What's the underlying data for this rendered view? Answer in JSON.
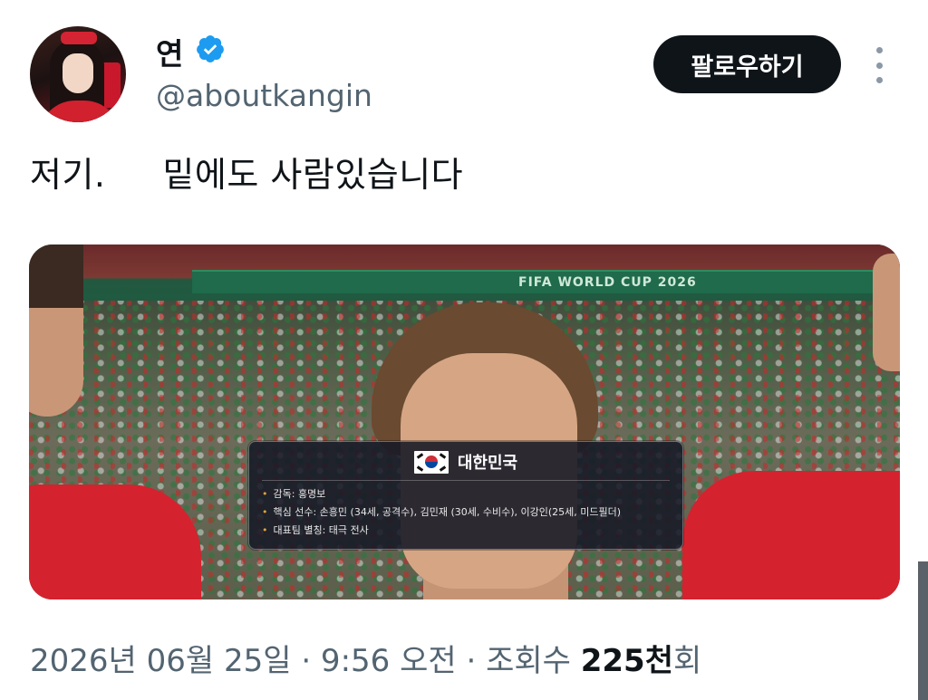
{
  "author": {
    "display_name": "연",
    "handle": "@aboutkangin",
    "verified_icon": "verified-badge-icon",
    "verified_color": "#1d9bf0"
  },
  "actions": {
    "follow_label": "팔로우하기",
    "more_icon": "more-vertical-icon"
  },
  "tweet": {
    "text": "저기.     밑에도 사람있습니다"
  },
  "media": {
    "banner_text": "FIFA WORLD CUP 2026",
    "info_card": {
      "flag_icon": "south-korea-flag-icon",
      "country": "대한민국",
      "lines": [
        "감독: 홍명보",
        "핵심 선수: 손흥민 (34세, 공격수), 김민재 (30세, 수비수), 이강인(25세, 미드필더)",
        "대표팀 별칭: 태극 전사"
      ]
    }
  },
  "meta": {
    "timestamp": "2026년 06월 25일 · 9:56 오전 · 조회수 ",
    "views_number": "225천",
    "views_suffix": "회"
  },
  "colors": {
    "text_primary": "#0f1419",
    "text_secondary": "#536471",
    "follow_button_bg": "#0f1419",
    "jersey_red": "#d5222f"
  }
}
